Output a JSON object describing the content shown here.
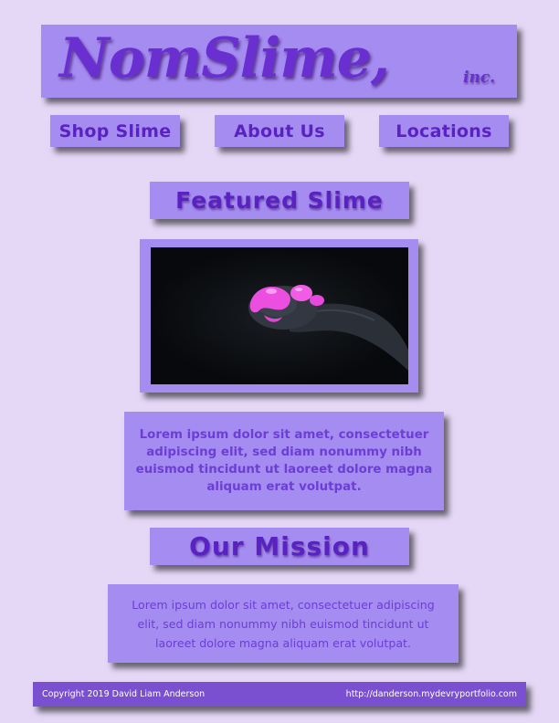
{
  "header": {
    "logo_text": "NomSlime,",
    "logo_suffix": "inc."
  },
  "nav": {
    "items": [
      {
        "label": "Shop Slime"
      },
      {
        "label": "About Us"
      },
      {
        "label": "Locations"
      }
    ]
  },
  "featured": {
    "title": "Featured Slime",
    "description": "Lorem ipsum dolor sit amet, consectetuer adipiscing elit, sed diam nonummy nibh euismod tincidunt ut laoreet dolore magna aliquam erat volutpat."
  },
  "mission": {
    "title": "Our Mission",
    "description": "Lorem ipsum dolor sit amet, consectetuer adipiscing elit, sed diam nonummy nibh euismod tincidunt ut laoreet dolore magna aliquam erat volutpat."
  },
  "footer": {
    "copyright": "Copyright 2019 David Liam Anderson",
    "url": "http://danderson.mydevryportfolio.com"
  },
  "colors": {
    "page_bg": "#e4d8f6",
    "box": "#a58cf0",
    "text": "#5a22c2",
    "footer_bg": "#7a4fd0",
    "slime_pink": "#ec4fe0"
  }
}
